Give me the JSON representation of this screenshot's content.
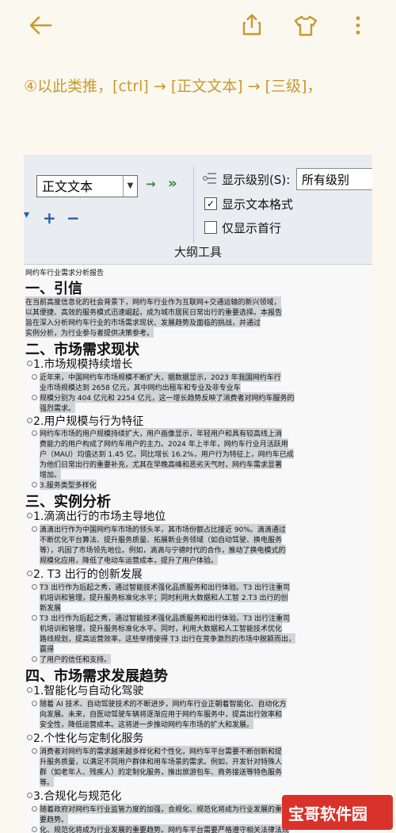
{
  "topbar": {
    "back_icon": "back-arrow-icon",
    "share_icon": "share-icon",
    "shirt_icon": "shirt-icon",
    "more_icon": "more-vertical-icon"
  },
  "caption": "④以此类推，[ctrl] → [正文文本] → [三级]，",
  "ribbon": {
    "style_value": "正文文本",
    "show_level_label": "显示级别(S):",
    "show_level_value": "所有级别",
    "show_text_format": "显示文本格式",
    "show_first_line": "仅显示首行",
    "group_label": "大纲工具",
    "plus": "+",
    "minus": "−",
    "arrow_right": "→",
    "arrow_double": "»"
  },
  "doc": {
    "report_title": "网约车行业需求分析报告",
    "s1": "一、引信",
    "s1_p1": "在当前高度信息化的社会背景下，网约车行业作为互联网+交通运输的新兴领域，",
    "s1_p2": "以其便捷、高效的服务模式迅速崛起，成为城市居民日常出行的重要选择。本报告",
    "s1_p3": "旨在深入分析网约车行业的市场需求现状、发展趋势及面临的挑战，并通过",
    "s1_p4": "实例分析，为行业参与者提供决策参考。",
    "s2": "二、市场需求现状",
    "s2_1": "1.市场规模持续增长",
    "s2_1_p1": "近年来，中国网约车市场规模不断扩大，据数据显示，2023 年我国网约车行",
    "s2_1_p2": "业市场规模达到 2658 亿元，其中网约出租车和专业及非专业车",
    "s2_1_p3": "规模分别为 404 亿元和 2254 亿元，这一增长趋势反映了消费者对网约车服务的",
    "s2_1_p4": "强烈需求。",
    "s2_2": "2.用户规模与行为特征",
    "s2_2_p1": "网约车市场的用户规模持续扩大，用户画像显示，年轻用户和具有较高线上消",
    "s2_2_p2": "费能力的用户构成了网约车用户的主力。2024 年上半年，网约车行业月活跃用",
    "s2_2_p3": "户（MAU）均值达到 1.45 亿，同比增长 16.2%，用户行为特征上，网约车已成",
    "s2_2_p4": "为他们日常出行的重要补充，尤其在早晚高峰和恶劣天气时，网约车需求显著",
    "s2_2_p5": "增加。",
    "s2_3": "3.服务类型多样化",
    "s3": "三、实例分析",
    "s3_1": "1.滴滴出行的市场主导地位",
    "s3_1_p1": "滴滴出行作为中国网约车市场的领头羊，其市场份额占比接近 90%。滴滴通过",
    "s3_1_p2": "不断优化平台算法、提升服务质量、拓展新业务领域（如自动驾驶、换电服务",
    "s3_1_p3": "等），巩固了市场领先地位。例如，滴滴与宁德时代的合作，推动了换电模式的",
    "s3_1_p4": "规模化应用，降低了电动车运营成本，提升了用户体验。",
    "s3_2": "2. T3 出行的创新发展",
    "s3_2_p1": "T3 出行作为后起之秀，通过智能技术强化品质服务和出行体验。T3 出行注重司",
    "s3_2_p2": "机培训和管理，提升服务标准化水平；同时利用大数据和人工智 2.T3 出行的创",
    "s3_2_p3": "新发展",
    "s3_2_p4": "T3 出行作为后起之秀，通过智能技术强化品质服务和出行体验。T3 出行注重司",
    "s3_2_p5": "机培训和管理，提升服务标准化水平。同时，利用大数据和人工智能技术优化",
    "s3_2_p6": "路线规划，提高运营效率，这些举措使得 T3 出行在竞争激烈的市场中脱颖而出，",
    "s3_2_p7": "赢得",
    "s3_2_p8": "了用户的信任和支持。",
    "s4": "四、市场需求发展趋势",
    "s4_1": "1.智能化与自动化驾驶",
    "s4_1_p1": "随着 AI 技术、自动驾驶技术的不断进步，网约车行业正朝着智能化、自动化方",
    "s4_1_p2": "向发展。未来，自医动驾驶车辆将逐渐应用于网约车服务中，提高出行效率和",
    "s4_1_p3": "安全性，降低运营成本。这将进一步推动网约车市场的扩大和发展。",
    "s4_2": "2.个性化与定制化服务",
    "s4_2_p1": "消费者对网约车的需求越来越多样化和个性化，网约车平台需要不断创新和提",
    "s4_2_p2": "升服务质量，以满足不同用户群体和用车场景的需求。例如，开发针对特殊人",
    "s4_2_p3": "群（如老年人、残疾人）的定制化服务，推出旅游包车、商务接送等特色服务",
    "s4_2_p4": "等。",
    "s4_3": "3.合规化与规范化",
    "s4_3_p1": "随着政府对网约车行业监管力度的加强，合规化、规范化将成为行业发展的重",
    "s4_3_p2": "要趋势。",
    "s4_3_p3": "化、规范化将成为行业发展的重要趋势。网约车平台需要严格遵守相关法律法规"
  },
  "watermark": {
    "text": "宝哥软件园",
    "color": "#d8322b"
  },
  "colors": {
    "caption": "#c89a30",
    "background": "#fbf8ef",
    "icons": "#c9992f"
  }
}
